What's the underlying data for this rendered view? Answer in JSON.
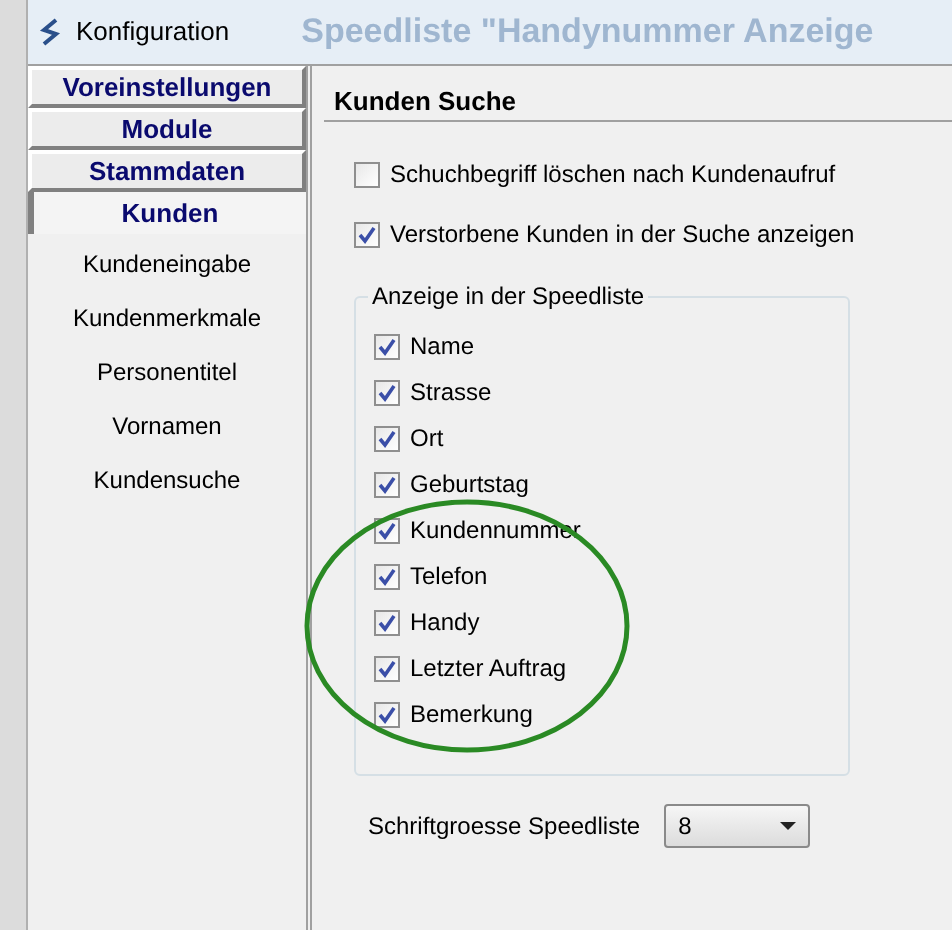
{
  "background_window": {
    "title": "Speedliste \"Handynummer Anzeige"
  },
  "window": {
    "title": "Konfiguration"
  },
  "nav": {
    "items": [
      {
        "kind": "section",
        "label": "Voreinstellungen",
        "selected": false
      },
      {
        "kind": "section",
        "label": "Module",
        "selected": false
      },
      {
        "kind": "section",
        "label": "Stammdaten",
        "selected": false
      },
      {
        "kind": "section",
        "label": "Kunden",
        "selected": true
      },
      {
        "kind": "sub",
        "label": "Kundeneingabe",
        "selected": false
      },
      {
        "kind": "sub",
        "label": "Kundenmerkmale",
        "selected": false
      },
      {
        "kind": "sub",
        "label": "Personentitel",
        "selected": false
      },
      {
        "kind": "sub",
        "label": "Vornamen",
        "selected": false
      },
      {
        "kind": "sub",
        "label": "Kundensuche",
        "selected": false
      }
    ]
  },
  "panel": {
    "title": "Kunden Suche",
    "options": [
      {
        "label": "Schuchbegriff löschen nach Kundenaufruf",
        "checked": false
      },
      {
        "label": "Verstorbene Kunden in der Suche anzeigen",
        "checked": true
      }
    ],
    "group": {
      "title": "Anzeige in der Speedliste",
      "items": [
        {
          "label": "Name",
          "checked": true
        },
        {
          "label": "Strasse",
          "checked": true
        },
        {
          "label": "Ort",
          "checked": true
        },
        {
          "label": "Geburtstag",
          "checked": true
        },
        {
          "label": "Kundennummer",
          "checked": true
        },
        {
          "label": "Telefon",
          "checked": true
        },
        {
          "label": "Handy",
          "checked": true
        },
        {
          "label": "Letzter Auftrag",
          "checked": true
        },
        {
          "label": "Bemerkung",
          "checked": true
        }
      ]
    },
    "font_size": {
      "label": "Schriftgroesse Speedliste",
      "value": "8"
    }
  }
}
